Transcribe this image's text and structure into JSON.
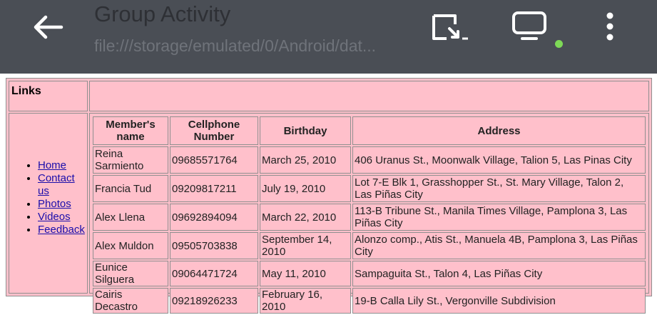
{
  "appbar": {
    "title": "Group Activity",
    "url": "file:///storage/emulated/0/Android/dat...",
    "colors": {
      "background": "#4a4e55",
      "status_dot": "#7ed957"
    },
    "icons": [
      "arrow-left-icon",
      "cast-icon",
      "desktop-icon",
      "more-vert-icon"
    ]
  },
  "page": {
    "links_heading": "Links",
    "nav": [
      "Home",
      "Contact us",
      "Photos",
      "Videos",
      "Feedback"
    ],
    "table": {
      "headers": [
        "Member's name",
        "Cellphone Number",
        "Birthday",
        "Address"
      ],
      "rows": [
        [
          "Reina Sarmiento",
          "09685571764",
          "March 25, 2010",
          "406 Uranus St., Moonwalk Village, Talion 5, Las Pinas City"
        ],
        [
          "Francia Tud",
          "09209817211",
          "July 19, 2010",
          "Lot 7-E Blk 1, Grasshopper St., St. Mary Village, Talon 2, Las Piñas City"
        ],
        [
          "Alex Llena",
          "09692894094",
          "March 22, 2010",
          "113-B Tribune St., Manila Times Village, Pamplona 3, Las Piñas City"
        ],
        [
          "Alex Muldon",
          "09505703838",
          "September 14, 2010",
          "Alonzo comp., Atis St., Manuela 4B, Pamplona 3, Las Piñas City"
        ],
        [
          "Eunice Silguera",
          "09064471724",
          "May 11, 2010",
          "Sampaguita St., Talon 4, Las Piñas City"
        ],
        [
          "Cairis Decastro",
          "09218926233",
          "February 16, 2010",
          "19-B Calla Lily St., Vergonville Subdivision"
        ]
      ]
    },
    "colors": {
      "background": "#ffc0cb",
      "link": "#1a0dab",
      "border": "#8f8f8f"
    }
  }
}
